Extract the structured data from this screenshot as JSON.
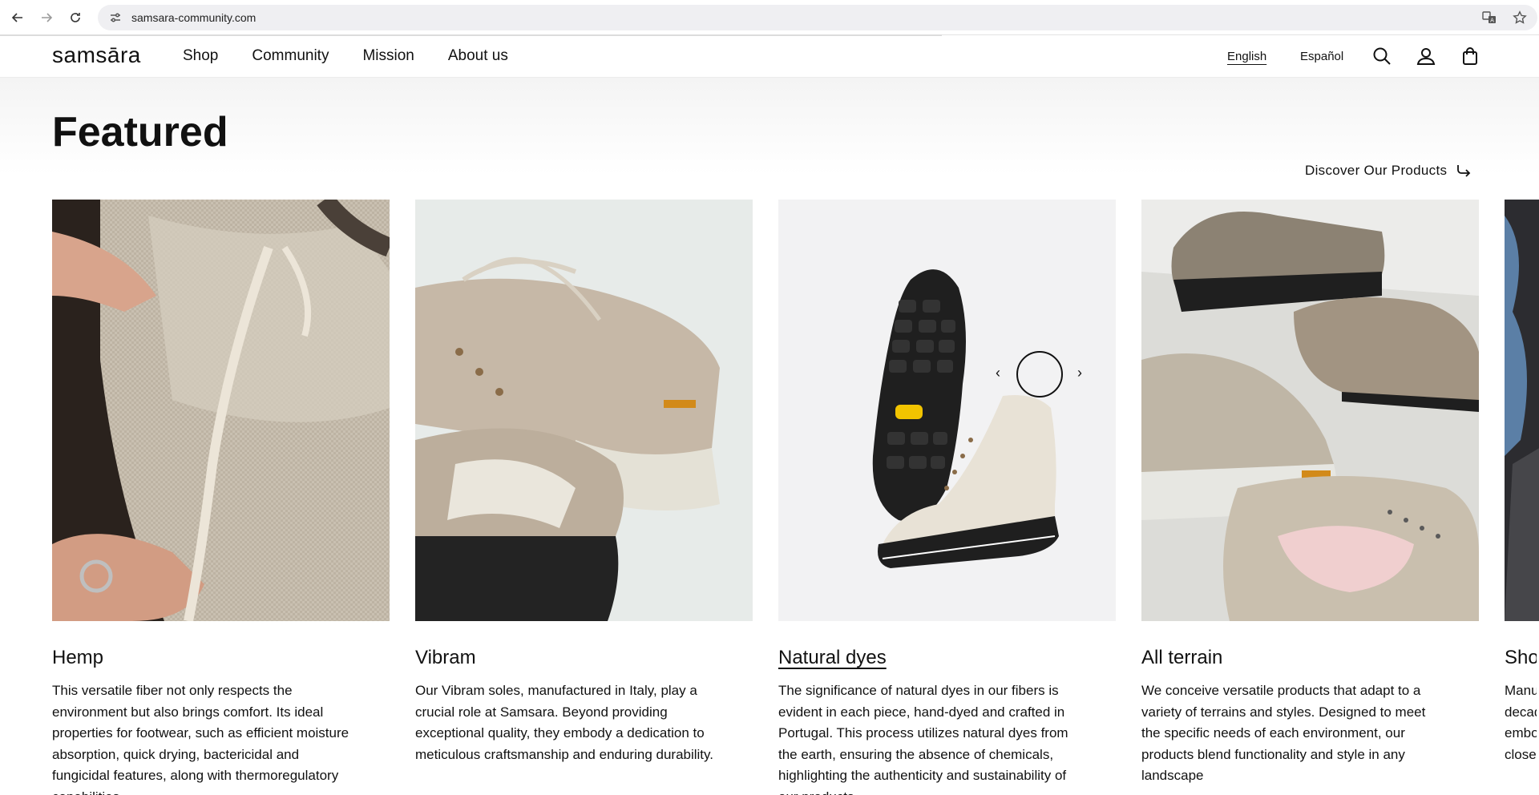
{
  "browser": {
    "url": "samsara-community.com"
  },
  "header": {
    "logo": "samsāra",
    "nav": [
      "Shop",
      "Community",
      "Mission",
      "About us"
    ],
    "languages": [
      "English",
      "Español"
    ],
    "icons": [
      "search-icon",
      "account-icon",
      "bag-icon"
    ]
  },
  "featured": {
    "title": "Featured",
    "discover_label": "Discover Our Products",
    "cards": [
      {
        "title": "Hemp",
        "description": "This versatile fiber not only respects the environment but also brings comfort. Its ideal properties for footwear, such as efficient moisture absorption, quick drying, bactericidal and fungicidal features, along with thermoregulatory capabilities."
      },
      {
        "title": "Vibram",
        "description": "Our Vibram soles, manufactured in Italy, play a crucial role at Samsara. Beyond providing exceptional quality, they embody a dedication to meticulous craftsmanship and enduring durability."
      },
      {
        "title": "Natural dyes",
        "description": "The significance of natural dyes in our fibers is evident in each piece, hand-dyed and crafted in Portugal. This process utilizes natural dyes from the earth, ensuring the absence of chemicals, highlighting the authenticity and sustainability of our products."
      },
      {
        "title": "All terrain",
        "description": "We conceive versatile products that adapt to a variety of terrains and styles. Designed to meet the specific needs of each environment, our products blend functionality and style in any landscape"
      },
      {
        "title": "Shoe",
        "description": "Manu decad embo close"
      }
    ]
  }
}
